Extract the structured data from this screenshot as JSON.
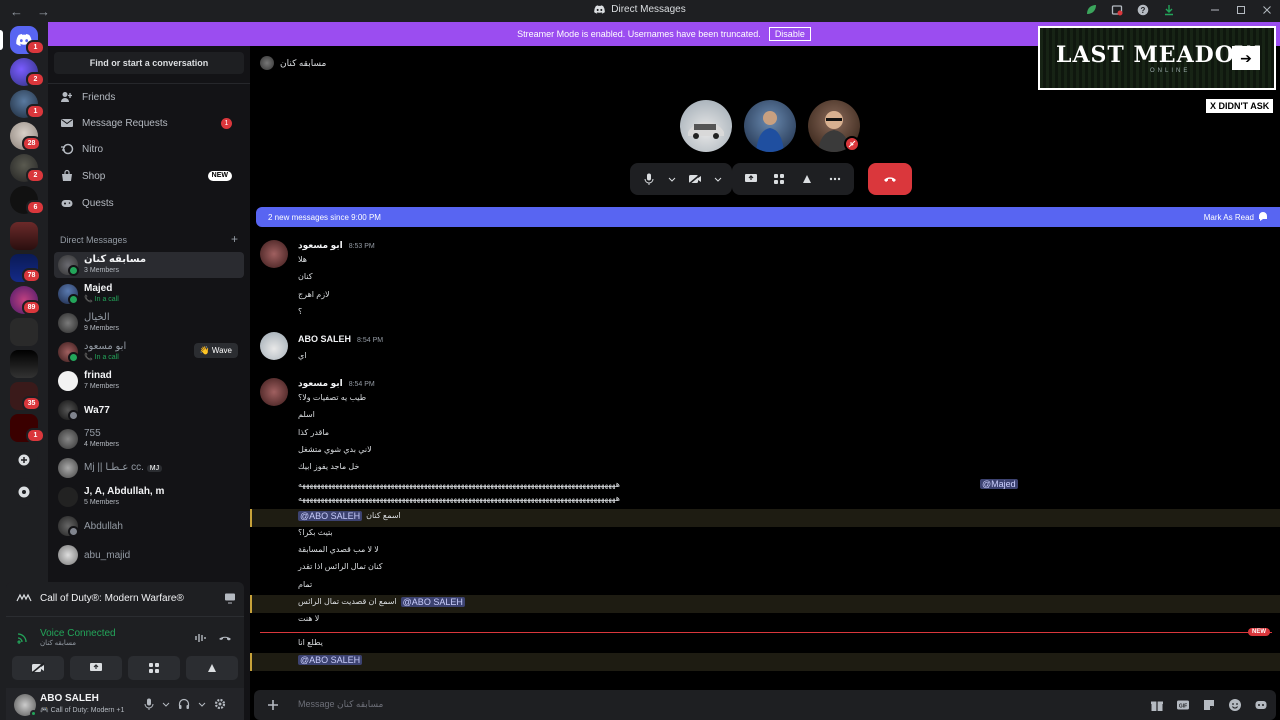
{
  "window": {
    "title": "Direct Messages",
    "back_glyph": "←",
    "forward_glyph": "→"
  },
  "streamer": {
    "message": "Streamer Mode is enabled. Usernames have been truncated.",
    "disable_label": "Disable"
  },
  "rail": {
    "badges": [
      "1",
      "2",
      "1",
      "28",
      "2",
      "6",
      "78",
      "89",
      "35",
      "1"
    ]
  },
  "sidebar": {
    "search_label": "Find or start a conversation",
    "nav": [
      {
        "label": "Friends",
        "icon": "friends-icon"
      },
      {
        "label": "Message Requests",
        "icon": "mail-icon",
        "count": "1"
      },
      {
        "label": "Nitro",
        "icon": "nitro-icon"
      },
      {
        "label": "Shop",
        "icon": "shop-icon",
        "tag": "NEW"
      },
      {
        "label": "Quests",
        "icon": "quests-icon"
      }
    ],
    "dm_header": "Direct Messages",
    "dm_add": "+",
    "dms": [
      {
        "name": "مسابقه كنان",
        "sub": "3 Members"
      },
      {
        "name": "Majed",
        "sub": "In a call"
      },
      {
        "name": "الخيال",
        "sub": "9 Members"
      },
      {
        "name": "ابو مسعود",
        "sub": "In a call",
        "wave": "👋 Wave"
      },
      {
        "name": "frinad",
        "sub": "7 Members"
      },
      {
        "name": "Wa77",
        "sub": ""
      },
      {
        "name": "755",
        "sub": "4 Members"
      },
      {
        "name": "Mj || عـطـا cc.",
        "sub": "",
        "tag": "MJ"
      },
      {
        "name": "J, A, Abdullah, m",
        "sub": "5 Members"
      },
      {
        "name": "Abdullah",
        "sub": ""
      },
      {
        "name": "abu_majid",
        "sub": ""
      }
    ]
  },
  "activity": {
    "game": "Call of Duty®: Modern Warfare®"
  },
  "voice": {
    "status": "Voice Connected",
    "channel": "مسابقه كنان"
  },
  "user": {
    "name": "ABO SALEH",
    "status": "Call of Duty: Modern +1"
  },
  "channel": {
    "title": "مسابقه كنان"
  },
  "new_messages": {
    "text": "2 new messages since 9:00 PM",
    "action": "Mark As Read"
  },
  "messages": {
    "m1_author": "ابو مسعود",
    "m1_time": "8:53 PM",
    "m1_lines": [
      "هلا",
      "كنان",
      "لازم اهرج",
      "؟"
    ],
    "m2_author": "ABO SALEH",
    "m2_time": "8:54 PM",
    "m2_lines": [
      "اي"
    ],
    "m3_author": "ابو مسعود",
    "m3_time": "8:54 PM",
    "m3_lines": [
      "طيب يه تصفيات ولا؟",
      "اسلم",
      "ماقدر كذا",
      "لاني بدي شوي متشغل",
      "خل ماجد يفوز ابيك"
    ],
    "spam_line": "ههههههههههههههههههههههههههههههههههههههههههههههههههههههههههههههههههههههههههههههههههههههه",
    "mention_majed": "@Majed",
    "mention_abo": "@ABO SALEH",
    "l_esm": "اسمع كنان",
    "l1": "بتيث بكرا؟",
    "l2": "لا لا مب قصدي المسابقة",
    "l3": "كنان تمال الرائس اذا تقدر",
    "l4": "تمام",
    "l5": "اسمع ان قصديت تمال الرائس",
    "l6": "لا هنت",
    "new_tag": "NEW",
    "l7": "يطلع انا"
  },
  "composer": {
    "placeholder": "Message مسابقه كنان"
  },
  "overlay": {
    "logo": "LAST MEADOW",
    "logo_sub": "ONLINE",
    "arrow": "➔",
    "caption": "X DIDN'T ASK"
  },
  "colors": {
    "blurple": "#5865f2",
    "streamer": "#9b4df0",
    "danger": "#da373c",
    "online": "#23a55a"
  }
}
